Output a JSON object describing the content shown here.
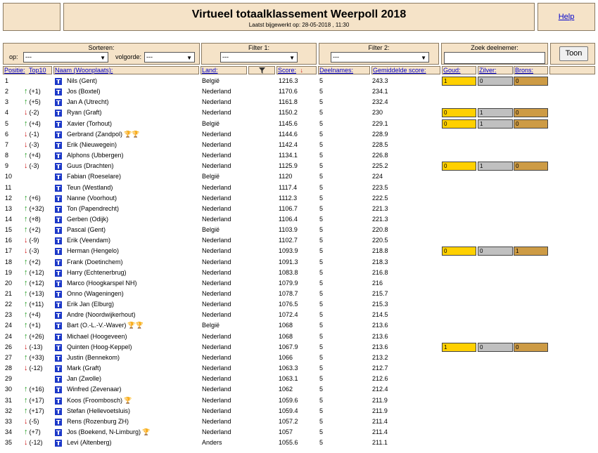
{
  "header": {
    "title": "Virtueel totaalklassement Weerpoll 2018",
    "updated": "Laatst bijgewerkt op: 28-05-2018 , 11:30",
    "help": "Help"
  },
  "controls": {
    "sort_label": "Sorteren:",
    "op_label": "op:",
    "op_value": "---",
    "order_label": "volgorde:",
    "order_value": "---",
    "filter1_label": "Filter 1:",
    "filter1_value": "---",
    "filter2_label": "Filter 2:",
    "filter2_value": "---",
    "search_label": "Zoek deelnemer:",
    "search_value": "",
    "toon": "Toon"
  },
  "columns": {
    "positie": "Positie:",
    "top10": "Top10",
    "naam": "Naam (Woonplaats):",
    "land": "Land:",
    "score": "Score:",
    "deelnames": "Deelnames:",
    "gemiddelde": "Gemiddelde score:",
    "goud": "Goud:",
    "zilver": "Zilver:",
    "brons": "Brons:"
  },
  "rows": [
    {
      "pos": "1",
      "dir": "",
      "chg": "",
      "name": "Nils (Gent)",
      "land": "België",
      "score": "1216.3",
      "deel": "5",
      "gem": "243.3",
      "medals": [
        "1",
        "0",
        "0"
      ]
    },
    {
      "pos": "2",
      "dir": "up",
      "chg": "(+1)",
      "name": "Jos (Boxtel)",
      "land": "Nederland",
      "score": "1170.6",
      "deel": "5",
      "gem": "234.1"
    },
    {
      "pos": "3",
      "dir": "up",
      "chg": "(+5)",
      "name": "Jan A (Utrecht)",
      "land": "Nederland",
      "score": "1161.8",
      "deel": "5",
      "gem": "232.4"
    },
    {
      "pos": "4",
      "dir": "down",
      "chg": "(-2)",
      "name": "Ryan (Graft)",
      "land": "Nederland",
      "score": "1150.2",
      "deel": "5",
      "gem": "230",
      "medals": [
        "0",
        "1",
        "0"
      ]
    },
    {
      "pos": "5",
      "dir": "up",
      "chg": "(+4)",
      "name": "Xavier (Torhout)",
      "land": "België",
      "score": "1145.6",
      "deel": "5",
      "gem": "229.1",
      "medals": [
        "0",
        "1",
        "0"
      ]
    },
    {
      "pos": "6",
      "dir": "down",
      "chg": "(-1)",
      "name": "Gerbrand (Zandpol)",
      "trophies": "🏆🏆",
      "land": "Nederland",
      "score": "1144.6",
      "deel": "5",
      "gem": "228.9"
    },
    {
      "pos": "7",
      "dir": "down",
      "chg": "(-3)",
      "name": "Erik (Nieuwegein)",
      "land": "Nederland",
      "score": "1142.4",
      "deel": "5",
      "gem": "228.5"
    },
    {
      "pos": "8",
      "dir": "up",
      "chg": "(+4)",
      "name": "Alphons (Ubbergen)",
      "land": "Nederland",
      "score": "1134.1",
      "deel": "5",
      "gem": "226.8"
    },
    {
      "pos": "9",
      "dir": "down",
      "chg": "(-3)",
      "name": "Guus (Drachten)",
      "land": "Nederland",
      "score": "1125.9",
      "deel": "5",
      "gem": "225.2",
      "medals": [
        "0",
        "1",
        "0"
      ]
    },
    {
      "pos": "10",
      "dir": "",
      "chg": "",
      "name": "Fabian (Roeselare)",
      "land": "België",
      "score": "1120",
      "deel": "5",
      "gem": "224"
    },
    {
      "pos": "11",
      "dir": "",
      "chg": "",
      "name": "Teun (Westland)",
      "land": "Nederland",
      "score": "1117.4",
      "deel": "5",
      "gem": "223.5"
    },
    {
      "pos": "12",
      "dir": "up",
      "chg": "(+6)",
      "name": "Nanne (Voorhout)",
      "land": "Nederland",
      "score": "1112.3",
      "deel": "5",
      "gem": "222.5"
    },
    {
      "pos": "13",
      "dir": "up",
      "chg": "(+32)",
      "name": "Ton (Papendrecht)",
      "land": "Nederland",
      "score": "1106.7",
      "deel": "5",
      "gem": "221.3"
    },
    {
      "pos": "14",
      "dir": "up",
      "chg": "(+8)",
      "name": "Gerben (Odijk)",
      "land": "Nederland",
      "score": "1106.4",
      "deel": "5",
      "gem": "221.3"
    },
    {
      "pos": "15",
      "dir": "up",
      "chg": "(+2)",
      "name": "Pascal (Gent)",
      "land": "België",
      "score": "1103.9",
      "deel": "5",
      "gem": "220.8"
    },
    {
      "pos": "16",
      "dir": "down",
      "chg": "(-9)",
      "name": "Erik (Veendam)",
      "land": "Nederland",
      "score": "1102.7",
      "deel": "5",
      "gem": "220.5"
    },
    {
      "pos": "17",
      "dir": "down",
      "chg": "(-3)",
      "name": "Herman (Hengelo)",
      "land": "Nederland",
      "score": "1093.9",
      "deel": "5",
      "gem": "218.8",
      "medals": [
        "0",
        "0",
        "1"
      ]
    },
    {
      "pos": "18",
      "dir": "up",
      "chg": "(+2)",
      "name": "Frank (Doetinchem)",
      "land": "Nederland",
      "score": "1091.3",
      "deel": "5",
      "gem": "218.3"
    },
    {
      "pos": "19",
      "dir": "up",
      "chg": "(+12)",
      "name": "Harry (Echtenerbrug)",
      "land": "Nederland",
      "score": "1083.8",
      "deel": "5",
      "gem": "216.8"
    },
    {
      "pos": "20",
      "dir": "up",
      "chg": "(+12)",
      "name": "Marco (Hoogkarspel NH)",
      "land": "Nederland",
      "score": "1079.9",
      "deel": "5",
      "gem": "216"
    },
    {
      "pos": "21",
      "dir": "up",
      "chg": "(+13)",
      "name": "Onno (Wageningen)",
      "land": "Nederland",
      "score": "1078.7",
      "deel": "5",
      "gem": "215.7"
    },
    {
      "pos": "22",
      "dir": "up",
      "chg": "(+11)",
      "name": "Erik Jan (Elburg)",
      "land": "Nederland",
      "score": "1076.5",
      "deel": "5",
      "gem": "215.3"
    },
    {
      "pos": "23",
      "dir": "up",
      "chg": "(+4)",
      "name": "Andre (Noordwijkerhout)",
      "land": "Nederland",
      "score": "1072.4",
      "deel": "5",
      "gem": "214.5"
    },
    {
      "pos": "24",
      "dir": "up",
      "chg": "(+1)",
      "name": "Bart (O.-L.-V.-Waver)",
      "trophies": "🏆🏆",
      "land": "België",
      "score": "1068",
      "deel": "5",
      "gem": "213.6"
    },
    {
      "pos": "24",
      "dir": "up",
      "chg": "(+26)",
      "name": "Michael (Hoogeveen)",
      "land": "Nederland",
      "score": "1068",
      "deel": "5",
      "gem": "213.6"
    },
    {
      "pos": "26",
      "dir": "down",
      "chg": "(-13)",
      "name": "Quinten (Hoog-Keppel)",
      "land": "Nederland",
      "score": "1067.9",
      "deel": "5",
      "gem": "213.6",
      "medals": [
        "1",
        "0",
        "0"
      ]
    },
    {
      "pos": "27",
      "dir": "up",
      "chg": "(+33)",
      "name": "Justin (Bennekom)",
      "land": "Nederland",
      "score": "1066",
      "deel": "5",
      "gem": "213.2"
    },
    {
      "pos": "28",
      "dir": "down",
      "chg": "(-12)",
      "name": "Mark (Graft)",
      "land": "Nederland",
      "score": "1063.3",
      "deel": "5",
      "gem": "212.7"
    },
    {
      "pos": "29",
      "dir": "",
      "chg": "",
      "name": "Jan (Zwolle)",
      "land": "Nederland",
      "score": "1063.1",
      "deel": "5",
      "gem": "212.6"
    },
    {
      "pos": "30",
      "dir": "up",
      "chg": "(+16)",
      "name": "Winfred (Zevenaar)",
      "land": "Nederland",
      "score": "1062",
      "deel": "5",
      "gem": "212.4"
    },
    {
      "pos": "31",
      "dir": "up",
      "chg": "(+17)",
      "name": "Koos (Froombosch)",
      "trophies": "🏆",
      "land": "Nederland",
      "score": "1059.6",
      "deel": "5",
      "gem": "211.9"
    },
    {
      "pos": "32",
      "dir": "up",
      "chg": "(+17)",
      "name": "Stefan (Hellevoetsluis)",
      "land": "Nederland",
      "score": "1059.4",
      "deel": "5",
      "gem": "211.9"
    },
    {
      "pos": "33",
      "dir": "down",
      "chg": "(-5)",
      "name": "Rens (Rozenburg ZH)",
      "land": "Nederland",
      "score": "1057.2",
      "deel": "5",
      "gem": "211.4"
    },
    {
      "pos": "34",
      "dir": "up",
      "chg": "(+7)",
      "name": "Jos (Boekend, N-Limburg)",
      "trophies": "🏆",
      "land": "Nederland",
      "score": "1057",
      "deel": "5",
      "gem": "211.4"
    },
    {
      "pos": "35",
      "dir": "down",
      "chg": "(-12)",
      "name": "Levi (Altenberg)",
      "land": "Anders",
      "score": "1055.6",
      "deel": "5",
      "gem": "211.1"
    }
  ],
  "icons": {
    "flag": "flag-icon",
    "filter": "filter-funnel-icon",
    "sort": "sort-desc-arrow-icon",
    "trophy": "trophy-icon"
  },
  "colors": {
    "panel_bg": "#f5e3c8",
    "gold": "#ffd000",
    "silver": "#c0c0c0",
    "bronze": "#cd9b45",
    "up": "#1a9a1a",
    "down": "#cc1111",
    "link": "#0000cc"
  }
}
